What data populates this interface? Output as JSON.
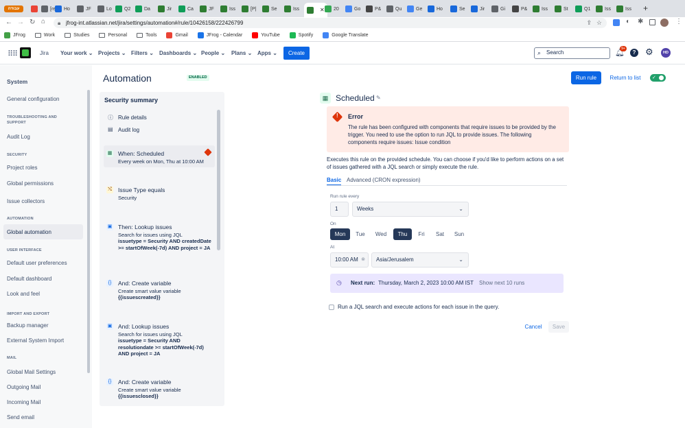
{
  "browser": {
    "tabs": [
      {
        "label": "עבודה",
        "icon": "profile-icon",
        "color": "#e37400"
      },
      {
        "label": "",
        "icon": "gmail-icon",
        "color": "#ea4335"
      },
      {
        "label": "[re",
        "icon": "doc-icon",
        "color": "#5f6368"
      },
      {
        "label": "Ho",
        "icon": "confluence-icon",
        "color": "#1868db"
      },
      {
        "label": "JF",
        "icon": "doc-icon",
        "color": "#5f6368"
      },
      {
        "label": "Lo",
        "icon": "doc-icon",
        "color": "#5f6368"
      },
      {
        "label": "Q2",
        "icon": "sheets-icon",
        "color": "#0f9d58"
      },
      {
        "label": "Da",
        "icon": "sheets-icon",
        "color": "#0f9d58"
      },
      {
        "label": "Jir",
        "icon": "jfrog-icon",
        "color": "#2e7d32"
      },
      {
        "label": "Ca",
        "icon": "sheets-icon",
        "color": "#0f9d58"
      },
      {
        "label": "JF",
        "icon": "jfrog-icon",
        "color": "#2e7d32"
      },
      {
        "label": "Iss",
        "icon": "jfrog-icon",
        "color": "#2e7d32"
      },
      {
        "label": "[P|",
        "icon": "jfrog-icon",
        "color": "#2e7d32"
      },
      {
        "label": "Se",
        "icon": "jfrog-icon",
        "color": "#2e7d32"
      },
      {
        "label": "Iss",
        "icon": "jfrog-icon",
        "color": "#2e7d32"
      },
      {
        "label": "",
        "icon": "jfrog-icon",
        "color": "#2e7d32"
      },
      {
        "label": "20",
        "icon": "green-icon",
        "color": "#34a853"
      },
      {
        "label": "Go",
        "icon": "google-icon",
        "color": "#4285f4"
      },
      {
        "label": "P&",
        "icon": "bug-icon",
        "color": "#444444"
      },
      {
        "label": "Qu",
        "icon": "doc-icon",
        "color": "#5f6368"
      },
      {
        "label": "Ge",
        "icon": "google-icon",
        "color": "#4285f4"
      },
      {
        "label": "Ho",
        "icon": "confluence-icon",
        "color": "#1868db"
      },
      {
        "label": "Se",
        "icon": "confluence-icon",
        "color": "#1868db"
      },
      {
        "label": "Jir",
        "icon": "confluence-icon",
        "color": "#1868db"
      },
      {
        "label": "Gi",
        "icon": "doc-icon",
        "color": "#5f6368"
      },
      {
        "label": "P&",
        "icon": "bug-icon",
        "color": "#444444"
      },
      {
        "label": "Iss",
        "icon": "jfrog-icon",
        "color": "#2e7d32"
      },
      {
        "label": "St",
        "icon": "jfrog-icon",
        "color": "#2e7d32"
      },
      {
        "label": "Q1",
        "icon": "sheets-icon",
        "color": "#0f9d58"
      },
      {
        "label": "Iss",
        "icon": "jfrog-icon",
        "color": "#2e7d32"
      },
      {
        "label": "Iss",
        "icon": "jfrog-icon",
        "color": "#2e7d32"
      }
    ],
    "url": "jfrog-int.atlassian.net/jira/settings/automation#/rule/10426158/222426799",
    "bookmarks": [
      "JFrog",
      "Work",
      "Studies",
      "Personal",
      "Tools",
      "Gmail",
      "JFrog - Calendar",
      "YouTube",
      "Spotify",
      "Google Translate"
    ]
  },
  "nav": {
    "app": "Jira",
    "your_work": "Your work",
    "projects": "Projects",
    "filters": "Filters",
    "dashboards": "Dashboards",
    "people": "People",
    "plans": "Plans",
    "apps": "Apps",
    "create": "Create",
    "search_placeholder": "Search",
    "notif_count": "9+",
    "avatar": "HD"
  },
  "sidebar": {
    "title": "System",
    "items": [
      {
        "type": "item",
        "label": "General configuration"
      },
      {
        "type": "header",
        "label": "TROUBLESHOOTING AND SUPPORT"
      },
      {
        "type": "item",
        "label": "Audit Log"
      },
      {
        "type": "header",
        "label": "SECURITY"
      },
      {
        "type": "item",
        "label": "Project roles"
      },
      {
        "type": "item",
        "label": "Global permissions"
      },
      {
        "type": "item",
        "label": "Issue collectors"
      },
      {
        "type": "header",
        "label": "AUTOMATION"
      },
      {
        "type": "item",
        "label": "Global automation",
        "selected": true
      },
      {
        "type": "header",
        "label": "USER INTERFACE"
      },
      {
        "type": "item",
        "label": "Default user preferences"
      },
      {
        "type": "item",
        "label": "Default dashboard"
      },
      {
        "type": "item",
        "label": "Look and feel"
      },
      {
        "type": "header",
        "label": "IMPORT AND EXPORT"
      },
      {
        "type": "item",
        "label": "Backup manager"
      },
      {
        "type": "item",
        "label": "External System Import"
      },
      {
        "type": "header",
        "label": "MAIL"
      },
      {
        "type": "item",
        "label": "Global Mail Settings"
      },
      {
        "type": "item",
        "label": "Outgoing Mail"
      },
      {
        "type": "item",
        "label": "Incoming Mail"
      },
      {
        "type": "item",
        "label": "Send email"
      }
    ]
  },
  "header": {
    "title": "Automation",
    "status": "ENABLED",
    "run_rule": "Run rule",
    "return": "Return to list"
  },
  "panel": {
    "title": "Security summary",
    "rule_details": "Rule details",
    "audit_log": "Audit log",
    "components": [
      {
        "title": "When: Scheduled",
        "desc": "Every week on Mon, Thu at 10:00 AM",
        "bold": "",
        "icon": "calendar-icon"
      },
      {
        "title": "Issue Type equals",
        "desc": "Security",
        "bold": "",
        "icon": "condition-icon"
      },
      {
        "title": "Then: Lookup issues",
        "desc": "Search for issues using JQL",
        "bold": "issuetype = Security AND createdDate >= startOfWeek(-7d) AND project = JA",
        "icon": "action-icon"
      },
      {
        "title": "And: Create variable",
        "desc": "Create smart value variable",
        "bold": "{{issuescreated}}",
        "icon": "variable-icon"
      },
      {
        "title": "And: Lookup issues",
        "desc": "Search for issues using JQL",
        "bold": "issuetype = Security AND resolutiondate >= startOfWeek(-7d) AND project = JA",
        "icon": "action-icon"
      },
      {
        "title": "And: Create variable",
        "desc": "Create smart value variable",
        "bold": "{{issuesclosed}}",
        "icon": "variable-icon"
      }
    ]
  },
  "detail": {
    "title": "Scheduled",
    "error_title": "Error",
    "error_text": "The rule has been configured with components that require issues to be provided by the trigger. You need to use the option to run JQL to provide issues. The following components require issues: Issue condition",
    "description": "Executes this rule on the provided schedule. You can choose if you'd like to perform actions on a set of issues gathered with a JQL search or simply execute the rule.",
    "tab_basic": "Basic",
    "tab_advanced": "Advanced (CRON expression)",
    "run_every_label": "Run rule every",
    "run_every_value": "1",
    "unit": "Weeks",
    "on_label": "On",
    "days": [
      {
        "label": "Mon",
        "selected": true
      },
      {
        "label": "Tue",
        "selected": false
      },
      {
        "label": "Wed",
        "selected": false
      },
      {
        "label": "Thu",
        "selected": true
      },
      {
        "label": "Fri",
        "selected": false
      },
      {
        "label": "Sat",
        "selected": false
      },
      {
        "label": "Sun",
        "selected": false
      }
    ],
    "at_label": "At",
    "time": "10:00 AM",
    "timezone": "Asia/Jerusalem",
    "next_run_label": "Next run:",
    "next_run_value": "Thursday, March 2, 2023 10:00 AM IST",
    "show_next": "Show next 10 runs",
    "jql_checkbox": "Run a JQL search and execute actions for each issue in the query.",
    "cancel": "Cancel",
    "save": "Save"
  }
}
